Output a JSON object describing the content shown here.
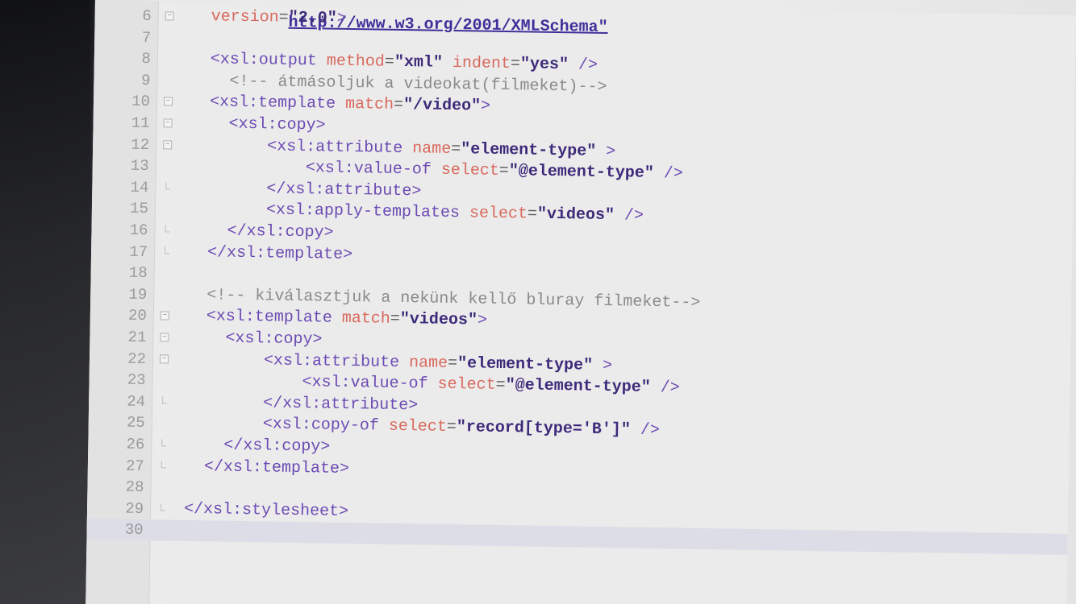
{
  "editor": {
    "lines": [
      {
        "num": "6",
        "fold": "open",
        "code": [
          {
            "t": "  version",
            "c": "attr"
          },
          {
            "t": "=",
            "c": "plain"
          },
          {
            "t": "\"2.0\"",
            "c": "val"
          },
          {
            "t": ">",
            "c": "tag"
          }
        ],
        "top_fragment": "http://www.w3.org/2001/XMLSchema\""
      },
      {
        "num": "7",
        "fold": "",
        "code": []
      },
      {
        "num": "8",
        "fold": "",
        "code": [
          {
            "t": "  <xsl:output ",
            "c": "tag"
          },
          {
            "t": "method",
            "c": "attr"
          },
          {
            "t": "=",
            "c": "plain"
          },
          {
            "t": "\"xml\"",
            "c": "val"
          },
          {
            "t": " indent",
            "c": "attr"
          },
          {
            "t": "=",
            "c": "plain"
          },
          {
            "t": "\"yes\"",
            "c": "val"
          },
          {
            "t": " />",
            "c": "tag"
          }
        ]
      },
      {
        "num": "9",
        "fold": "",
        "code": [
          {
            "t": "    <!-- átmásoljuk a videokat(filmeket)-->",
            "c": "cmt"
          }
        ]
      },
      {
        "num": "10",
        "fold": "open",
        "code": [
          {
            "t": "  <xsl:template ",
            "c": "tag"
          },
          {
            "t": "match",
            "c": "attr"
          },
          {
            "t": "=",
            "c": "plain"
          },
          {
            "t": "\"/video\"",
            "c": "val"
          },
          {
            "t": ">",
            "c": "tag"
          }
        ]
      },
      {
        "num": "11",
        "fold": "open",
        "code": [
          {
            "t": "    <xsl:copy>",
            "c": "tag"
          }
        ]
      },
      {
        "num": "12",
        "fold": "open",
        "code": [
          {
            "t": "        <xsl:attribute ",
            "c": "tag"
          },
          {
            "t": "name",
            "c": "attr"
          },
          {
            "t": "=",
            "c": "plain"
          },
          {
            "t": "\"element-type\"",
            "c": "val"
          },
          {
            "t": " >",
            "c": "tag"
          }
        ]
      },
      {
        "num": "13",
        "fold": "",
        "code": [
          {
            "t": "            <xsl:value-of ",
            "c": "tag"
          },
          {
            "t": "select",
            "c": "attr"
          },
          {
            "t": "=",
            "c": "plain"
          },
          {
            "t": "\"@element-type\"",
            "c": "val"
          },
          {
            "t": " />",
            "c": "tag"
          }
        ]
      },
      {
        "num": "14",
        "fold": "end",
        "code": [
          {
            "t": "        </xsl:attribute>",
            "c": "tag"
          }
        ]
      },
      {
        "num": "15",
        "fold": "",
        "code": [
          {
            "t": "        <xsl:apply-templates ",
            "c": "tag"
          },
          {
            "t": "select",
            "c": "attr"
          },
          {
            "t": "=",
            "c": "plain"
          },
          {
            "t": "\"videos\"",
            "c": "val"
          },
          {
            "t": " />",
            "c": "tag"
          }
        ]
      },
      {
        "num": "16",
        "fold": "end",
        "code": [
          {
            "t": "    </xsl:copy>",
            "c": "tag"
          }
        ]
      },
      {
        "num": "17",
        "fold": "end",
        "code": [
          {
            "t": "  </xsl:template>",
            "c": "tag"
          }
        ]
      },
      {
        "num": "18",
        "fold": "",
        "code": []
      },
      {
        "num": "19",
        "fold": "",
        "code": [
          {
            "t": "  <!-- kiválasztjuk a nekünk kellő bluray filmeket-->",
            "c": "cmt"
          }
        ]
      },
      {
        "num": "20",
        "fold": "open",
        "code": [
          {
            "t": "  <xsl:template ",
            "c": "tag"
          },
          {
            "t": "match",
            "c": "attr"
          },
          {
            "t": "=",
            "c": "plain"
          },
          {
            "t": "\"videos\"",
            "c": "val"
          },
          {
            "t": ">",
            "c": "tag"
          }
        ]
      },
      {
        "num": "21",
        "fold": "open",
        "code": [
          {
            "t": "    <xsl:copy>",
            "c": "tag"
          }
        ]
      },
      {
        "num": "22",
        "fold": "open",
        "code": [
          {
            "t": "        <xsl:attribute ",
            "c": "tag"
          },
          {
            "t": "name",
            "c": "attr"
          },
          {
            "t": "=",
            "c": "plain"
          },
          {
            "t": "\"element-type\"",
            "c": "val"
          },
          {
            "t": " >",
            "c": "tag"
          }
        ]
      },
      {
        "num": "23",
        "fold": "",
        "code": [
          {
            "t": "            <xsl:value-of ",
            "c": "tag"
          },
          {
            "t": "select",
            "c": "attr"
          },
          {
            "t": "=",
            "c": "plain"
          },
          {
            "t": "\"@element-type\"",
            "c": "val"
          },
          {
            "t": " />",
            "c": "tag"
          }
        ]
      },
      {
        "num": "24",
        "fold": "end",
        "code": [
          {
            "t": "        </xsl:attribute>",
            "c": "tag"
          }
        ]
      },
      {
        "num": "25",
        "fold": "",
        "code": [
          {
            "t": "        <xsl:copy-of ",
            "c": "tag"
          },
          {
            "t": "select",
            "c": "attr"
          },
          {
            "t": "=",
            "c": "plain"
          },
          {
            "t": "\"record[type='B']\"",
            "c": "val"
          },
          {
            "t": " />",
            "c": "tag"
          }
        ]
      },
      {
        "num": "26",
        "fold": "end",
        "code": [
          {
            "t": "    </xsl:copy>",
            "c": "tag"
          }
        ]
      },
      {
        "num": "27",
        "fold": "end",
        "code": [
          {
            "t": "  </xsl:template>",
            "c": "tag"
          }
        ]
      },
      {
        "num": "28",
        "fold": "",
        "code": []
      },
      {
        "num": "29",
        "fold": "end",
        "code": [
          {
            "t": "</xsl:stylesheet>",
            "c": "tag"
          }
        ]
      },
      {
        "num": "30",
        "fold": "",
        "code": [],
        "current": true
      }
    ]
  },
  "colors": {
    "tag": "#6c4bb4",
    "attribute": "#d9695d",
    "value": "#3d2a7a",
    "comment": "#8a8a8a",
    "current_line": "#dcdde6"
  }
}
